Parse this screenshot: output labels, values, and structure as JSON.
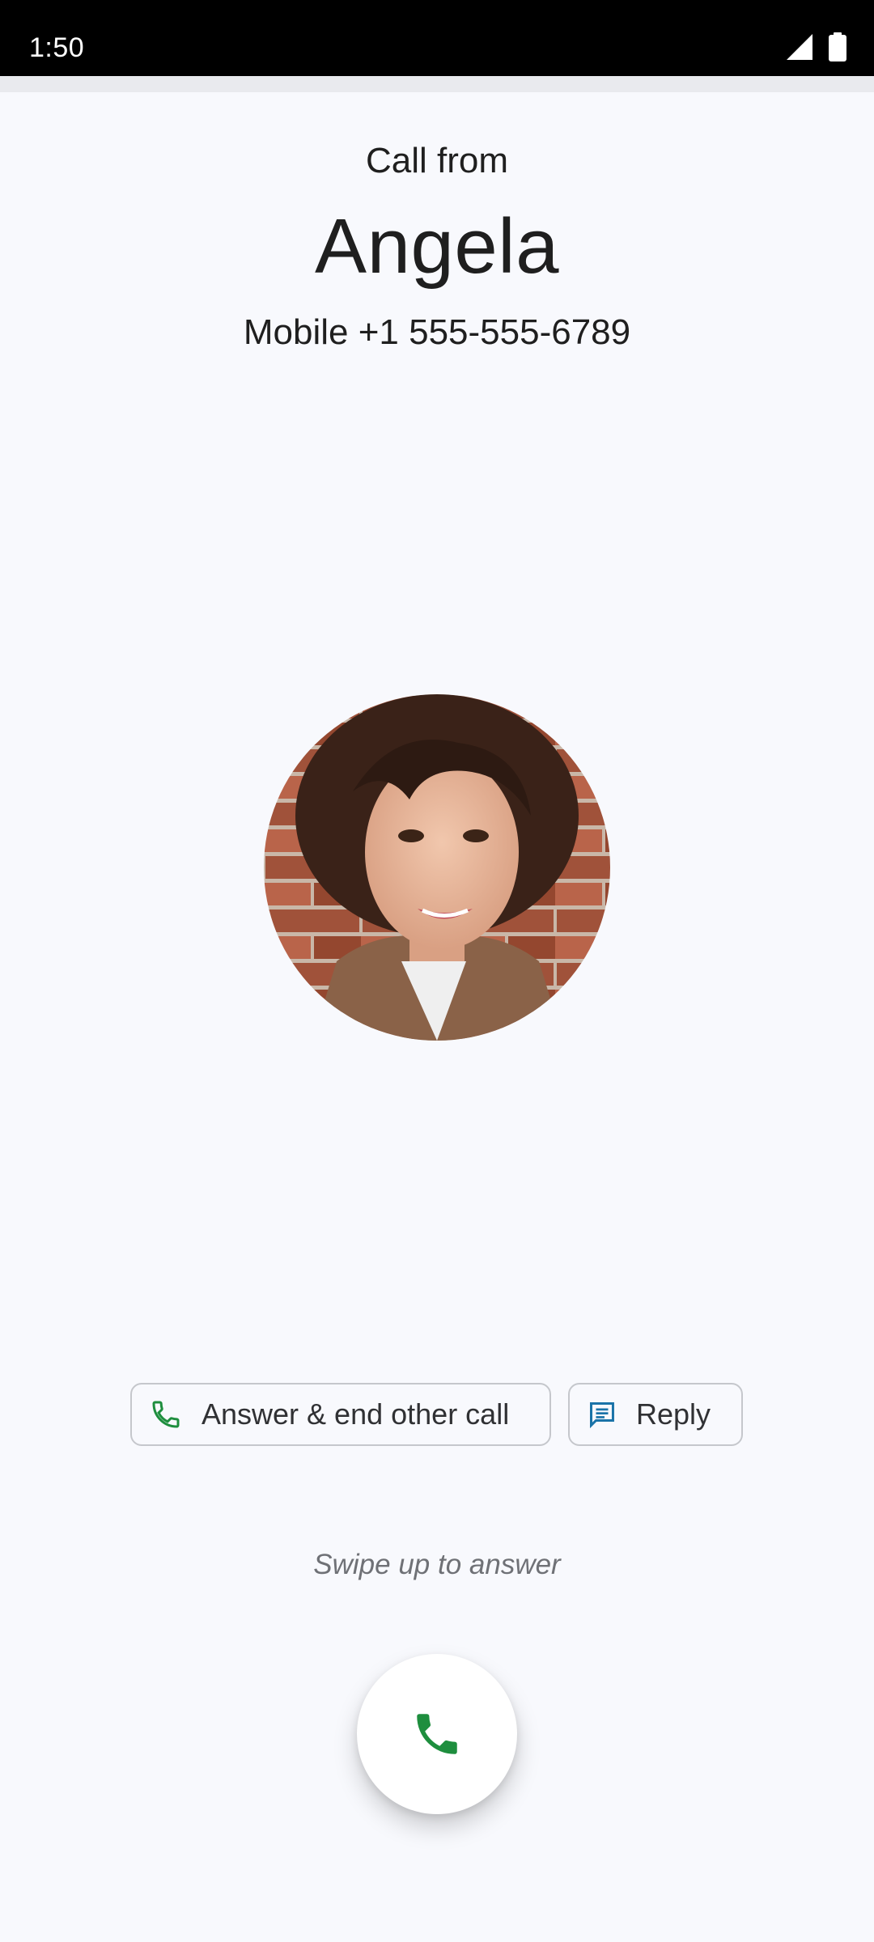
{
  "status_bar": {
    "time": "1:50",
    "icons": [
      "signal-icon",
      "battery-icon"
    ]
  },
  "caller": {
    "header": "Call from",
    "name": "Angela",
    "number": "Mobile +1 555-555-6789",
    "avatar_icon": "contact-photo"
  },
  "actions": {
    "answer_end_label": "Answer & end other call",
    "answer_end_icon": "phone-icon",
    "reply_label": "Reply",
    "reply_icon": "message-icon"
  },
  "swipe_hint": "Swipe up to answer",
  "answer_button": {
    "icon": "phone-icon"
  },
  "colors": {
    "background": "#f8f9fd",
    "answer_green": "#1e8e3e",
    "reply_blue": "#1a73a8",
    "chip_border": "#c5c7cc"
  }
}
